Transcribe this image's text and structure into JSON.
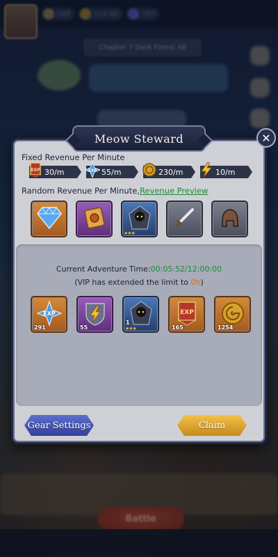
{
  "dialog": {
    "title": "Meow Steward",
    "close_label": "✕"
  },
  "fixed_revenue": {
    "label": "Fixed Revenue Per Minute",
    "items": [
      {
        "icon": "exp-banner-icon",
        "value": "30/m"
      },
      {
        "icon": "exp-star-icon",
        "value": "55/m"
      },
      {
        "icon": "gold-coin-icon",
        "value": "230/m"
      },
      {
        "icon": "lightning-icon",
        "value": "10/m"
      }
    ]
  },
  "random_revenue": {
    "label": "Random Revenue Per Minute,",
    "link": "Revenue Preview",
    "items": [
      {
        "icon": "diamond-icon"
      },
      {
        "icon": "scroll-coin-icon"
      },
      {
        "icon": "hooded-hero-icon"
      },
      {
        "icon": "sword-icon"
      },
      {
        "icon": "helmet-icon"
      }
    ]
  },
  "adventure": {
    "label": "Current Adventure Time:",
    "time": "00:05:52/12:00:00",
    "vip_prefix": "(VIP has extended the limit to ",
    "vip_value": "0h",
    "vip_suffix": ")"
  },
  "rewards": [
    {
      "icon": "exp-star-icon",
      "count": "291"
    },
    {
      "icon": "lightning-shield-icon",
      "count": "55"
    },
    {
      "icon": "hooded-hero-icon",
      "count": "1"
    },
    {
      "icon": "exp-banner-icon",
      "count": "165"
    },
    {
      "icon": "gold-coin-icon",
      "count": "1254"
    }
  ],
  "buttons": {
    "gear_settings": "Gear Settings",
    "claim": "Claim"
  },
  "background": {
    "battle_label": "Battle",
    "banner_text": "Chapter 7 Dark Forest 48",
    "resource_1": "288",
    "resource_2": "114.4K",
    "resource_3": "787"
  },
  "colors": {
    "green": "#1d8a36",
    "orange": "#d9721e",
    "panel": "#cfd0d6",
    "panel_border": "#1f2a44"
  }
}
